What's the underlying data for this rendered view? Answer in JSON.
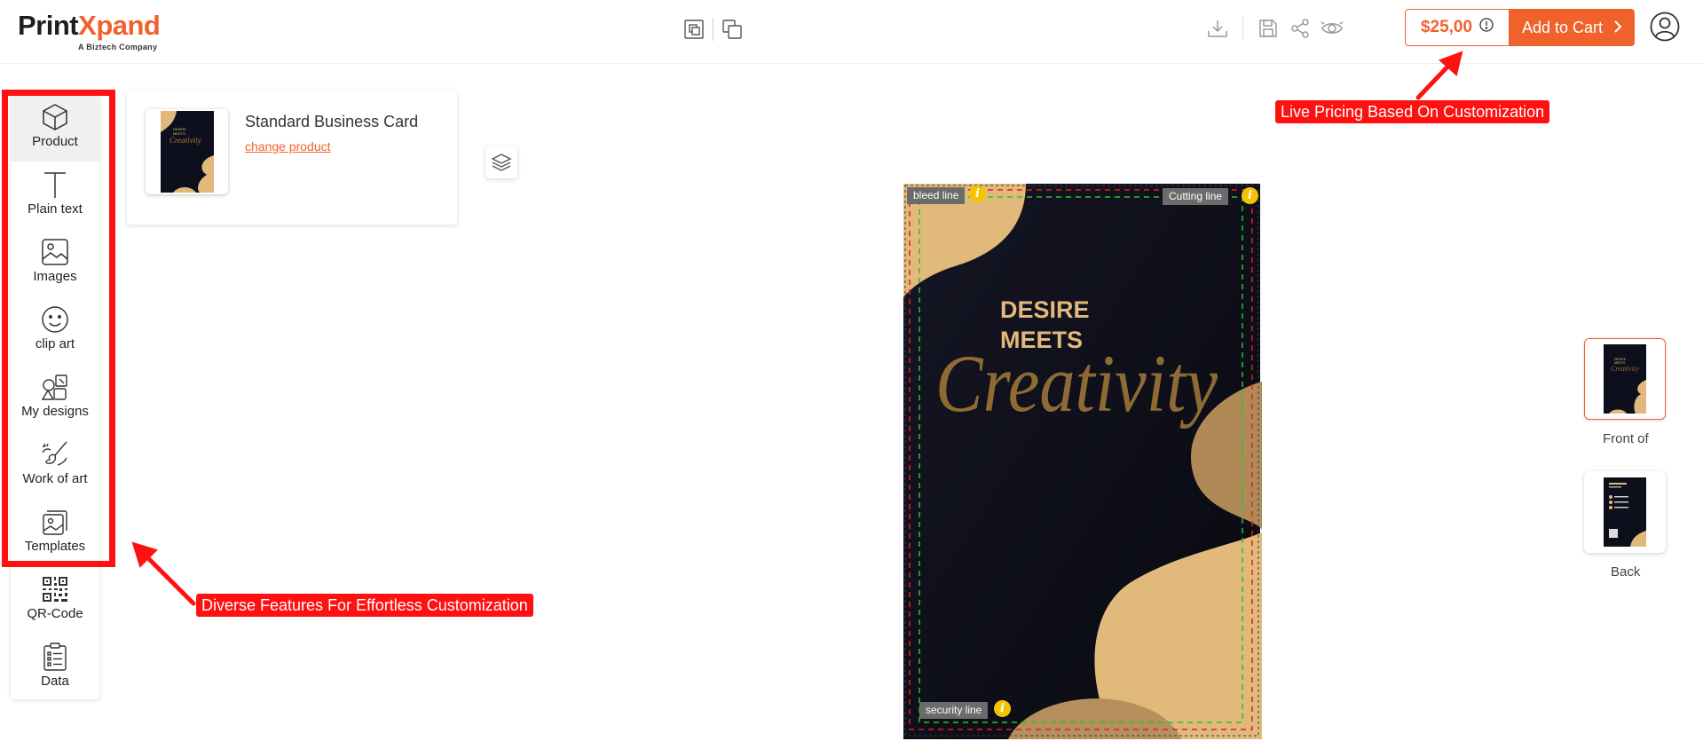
{
  "brand": {
    "name_prefix": "Print",
    "name_accent": "X",
    "name_suffix": "pand",
    "tagline": "A Biztech Company",
    "accent_color": "#f0622b"
  },
  "toolbar": {
    "center_icons": [
      "bring-forward-icon",
      "send-backward-icon"
    ],
    "right_icons": [
      "download-icon",
      "save-icon",
      "share-icon",
      "preview-eye-icon"
    ],
    "price": "$25,00",
    "price_info_icon": "exclamation-circle-icon",
    "add_to_cart_label": "Add to Cart",
    "add_to_cart_icon": "chevron-right-icon",
    "user_icon": "user-circle-icon"
  },
  "sidebar": {
    "items": [
      {
        "label": "Product",
        "icon": "cube-icon",
        "active": true
      },
      {
        "label": "Plain text",
        "icon": "text-t-icon"
      },
      {
        "label": "Images",
        "icon": "image-icon"
      },
      {
        "label": "clip art",
        "icon": "smiley-icon"
      },
      {
        "label": "My designs",
        "icon": "my-designs-icon"
      },
      {
        "label": "Work of art",
        "icon": "brush-icon"
      },
      {
        "label": "Templates",
        "icon": "templates-icon"
      },
      {
        "label": "QR-Code",
        "icon": "qr-code-icon"
      },
      {
        "label": "Data",
        "icon": "clipboard-list-icon"
      }
    ]
  },
  "product": {
    "name": "Standard Business Card",
    "change_link": "change product"
  },
  "canvas": {
    "bleed_label": "bleed line",
    "cutting_label": "Cutting line",
    "security_label": "security line",
    "info_glyph": "i",
    "headline_line1": "DESIRE",
    "headline_line2": "MEETS",
    "script_word": "Creativity",
    "background_color": "#0d0f1c",
    "shape_color": "#e1b97b",
    "bleed_color": "#e02020",
    "safe_color": "#2fbf2f"
  },
  "pages": [
    {
      "label": "Front of",
      "active": true
    },
    {
      "label": "Back",
      "active": false
    }
  ],
  "annotations": {
    "features": "Diverse Features For Effortless Customization",
    "pricing": "Live Pricing Based On Customization",
    "color": "#ff1111"
  }
}
